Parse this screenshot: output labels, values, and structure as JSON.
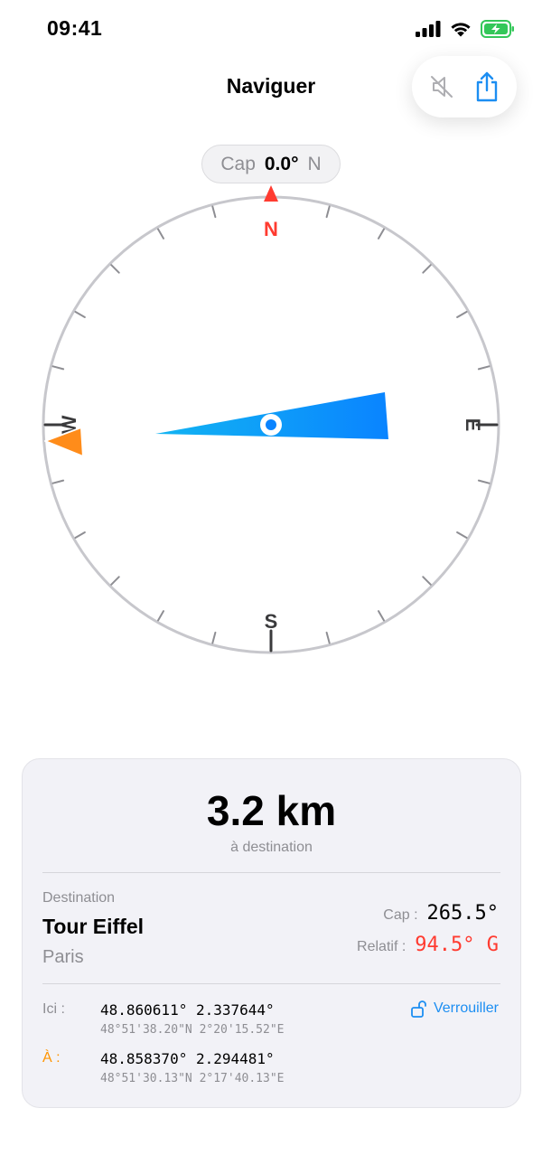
{
  "status": {
    "time": "09:41"
  },
  "nav": {
    "title": "Naviguer"
  },
  "toolbar": {
    "icons": [
      "speaker-muted-icon",
      "share-icon"
    ],
    "accent": "#1c8ef2"
  },
  "heading": {
    "label": "Cap",
    "value": "0.0°",
    "direction": "N"
  },
  "compass": {
    "cardinals": {
      "north": "N",
      "east": "E",
      "south": "S",
      "west": "W"
    },
    "north_color": "#ff3b30",
    "needle_color": "#0a84ff",
    "destination_marker_color": "#ff8c1a"
  },
  "summary": {
    "distance": "3.2 km",
    "distance_caption": "à destination"
  },
  "destination": {
    "label": "Destination",
    "name": "Tour Eiffel",
    "city": "Paris",
    "cap_label": "Cap :",
    "cap_value": "265.5°",
    "relative_label": "Relatif :",
    "relative_value": "94.5° G",
    "relative_color": "#ff3b30"
  },
  "coords": {
    "here_label": "Ici :",
    "here_decimal": "48.860611°  2.337644°",
    "here_dms": "48°51'38.20\"N 2°20'15.52\"E",
    "to_label": "À :",
    "to_decimal": "48.858370°  2.294481°",
    "to_dms": "48°51'30.13\"N 2°17'40.13\"E",
    "to_color": "#ff9500",
    "lock_label": "Verrouiller"
  }
}
